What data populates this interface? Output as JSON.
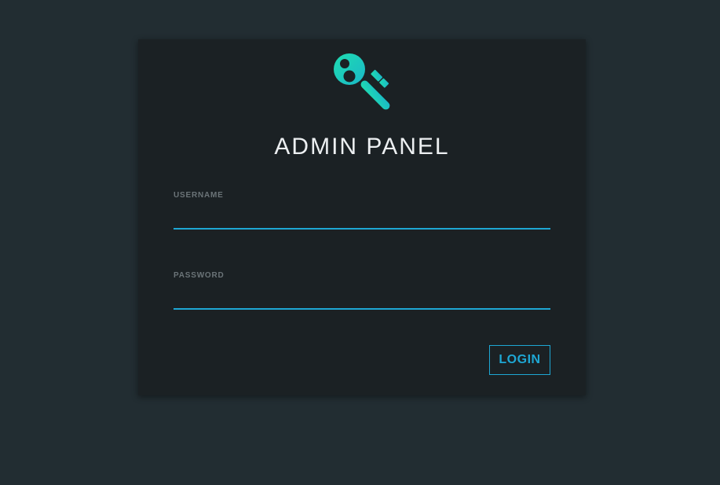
{
  "login": {
    "title": "ADMIN PANEL",
    "logo_icon": "key-icon",
    "username": {
      "label": "USERNAME",
      "value": "",
      "placeholder": ""
    },
    "password": {
      "label": "PASSWORD",
      "value": "",
      "placeholder": ""
    },
    "login_button_label": "LOGIN"
  },
  "colors": {
    "background": "#222d32",
    "card": "#1b2124",
    "accent": "#1ea7d4",
    "logo": "#1bd1b6",
    "title_text": "#eceff1",
    "label_text": "#6b7478"
  }
}
